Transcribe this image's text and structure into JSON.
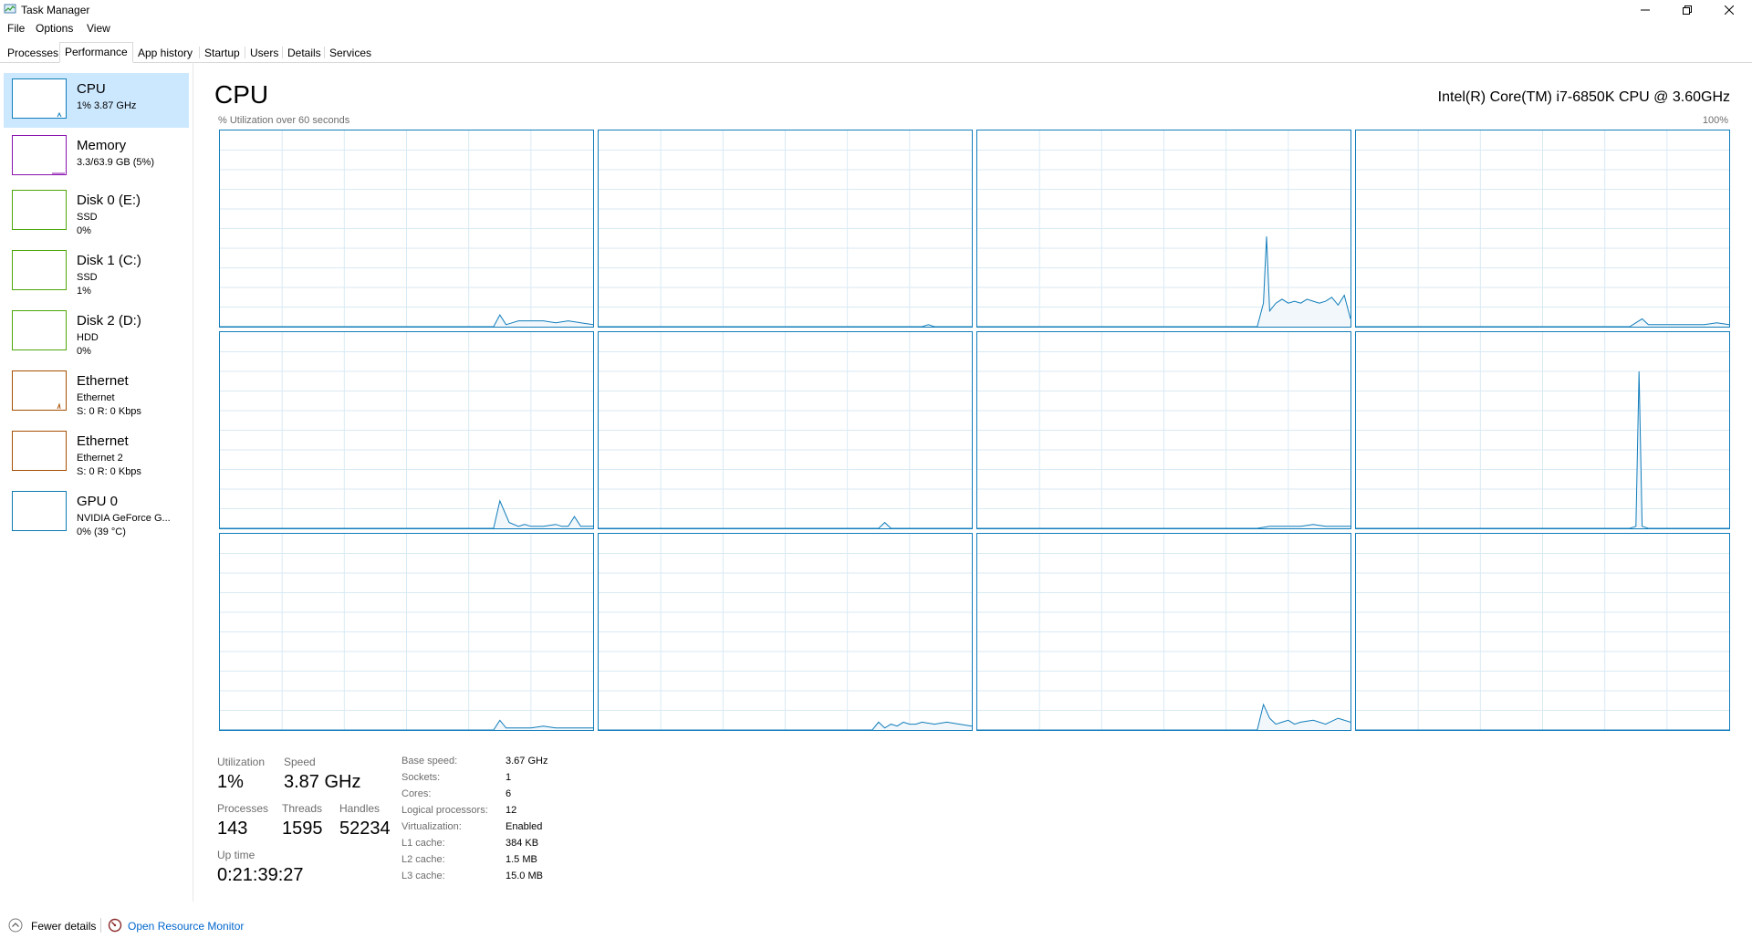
{
  "window": {
    "title": "Task Manager"
  },
  "menu": [
    "File",
    "Options",
    "View"
  ],
  "tabs": [
    "Processes",
    "Performance",
    "App history",
    "Startup",
    "Users",
    "Details",
    "Services"
  ],
  "sidebar": [
    {
      "title": "CPU",
      "lines": [
        "1% 3.87 GHz"
      ],
      "color": "#117dbb"
    },
    {
      "title": "Memory",
      "lines": [
        "3.3/63.9 GB (5%)"
      ],
      "color": "#8b12ae"
    },
    {
      "title": "Disk 0 (E:)",
      "lines": [
        "SSD",
        "0%"
      ],
      "color": "#4da60c"
    },
    {
      "title": "Disk 1 (C:)",
      "lines": [
        "SSD",
        "1%"
      ],
      "color": "#4da60c"
    },
    {
      "title": "Disk 2 (D:)",
      "lines": [
        "HDD",
        "0%"
      ],
      "color": "#4da60c"
    },
    {
      "title": "Ethernet",
      "lines": [
        "Ethernet",
        "S: 0 R: 0 Kbps"
      ],
      "color": "#a74f01"
    },
    {
      "title": "Ethernet",
      "lines": [
        "Ethernet 2",
        "S: 0 R: 0 Kbps"
      ],
      "color": "#a74f01"
    },
    {
      "title": "GPU 0",
      "lines": [
        "NVIDIA GeForce G...",
        "0% (39 °C)"
      ],
      "color": "#0e7bb0"
    }
  ],
  "main": {
    "title": "CPU",
    "cpu_model": "Intel(R) Core(TM) i7-6850K CPU @ 3.60GHz",
    "util_label": "% Utilization over 60 seconds",
    "util_max": "100%"
  },
  "chart_data": {
    "type": "area",
    "ylim": [
      0,
      100
    ],
    "xlim": [
      0,
      60
    ],
    "grid": true,
    "color": "#117dbb",
    "series": [
      {
        "values": [
          [
            0,
            0
          ],
          [
            44,
            0
          ],
          [
            45,
            6
          ],
          [
            46,
            1
          ],
          [
            47,
            2
          ],
          [
            48,
            3
          ],
          [
            50,
            3
          ],
          [
            52,
            3
          ],
          [
            54,
            2
          ],
          [
            56,
            3
          ],
          [
            58,
            2
          ],
          [
            60,
            1
          ]
        ]
      },
      {
        "values": [
          [
            0,
            0
          ],
          [
            52,
            0
          ],
          [
            53,
            1
          ],
          [
            54,
            0
          ],
          [
            60,
            0
          ]
        ]
      },
      {
        "values": [
          [
            0,
            0
          ],
          [
            45,
            0
          ],
          [
            46,
            12
          ],
          [
            46.5,
            46
          ],
          [
            47,
            8
          ],
          [
            48,
            12
          ],
          [
            49,
            14
          ],
          [
            50,
            12
          ],
          [
            51,
            13
          ],
          [
            52,
            12
          ],
          [
            53,
            14
          ],
          [
            54,
            13
          ],
          [
            55,
            12
          ],
          [
            56,
            13
          ],
          [
            57,
            15
          ],
          [
            58,
            11
          ],
          [
            59,
            16
          ],
          [
            60,
            4
          ]
        ]
      },
      {
        "values": [
          [
            0,
            0
          ],
          [
            44,
            0
          ],
          [
            46,
            4
          ],
          [
            47,
            1
          ],
          [
            50,
            1
          ],
          [
            53,
            1
          ],
          [
            56,
            1
          ],
          [
            58,
            2
          ],
          [
            60,
            1
          ]
        ]
      },
      {
        "values": [
          [
            0,
            0
          ],
          [
            44,
            0
          ],
          [
            45,
            14
          ],
          [
            46.5,
            3
          ],
          [
            48,
            1
          ],
          [
            49,
            2
          ],
          [
            50,
            1
          ],
          [
            52,
            1
          ],
          [
            54,
            2
          ],
          [
            55,
            1
          ],
          [
            56,
            1
          ],
          [
            57,
            6
          ],
          [
            58,
            1
          ],
          [
            59,
            1
          ],
          [
            60,
            1
          ]
        ]
      },
      {
        "values": [
          [
            0,
            0
          ],
          [
            45,
            0
          ],
          [
            46,
            3
          ],
          [
            47,
            0
          ],
          [
            60,
            0
          ]
        ]
      },
      {
        "values": [
          [
            0,
            0
          ],
          [
            45,
            0
          ],
          [
            47,
            1
          ],
          [
            50,
            1
          ],
          [
            52,
            1
          ],
          [
            54,
            2
          ],
          [
            56,
            1
          ],
          [
            58,
            1
          ],
          [
            60,
            1
          ]
        ]
      },
      {
        "values": [
          [
            0,
            0
          ],
          [
            44,
            0
          ],
          [
            45,
            1
          ],
          [
            45.5,
            80
          ],
          [
            46,
            1
          ],
          [
            47,
            0
          ],
          [
            60,
            0
          ]
        ]
      },
      {
        "values": [
          [
            0,
            0
          ],
          [
            44,
            0
          ],
          [
            45,
            5
          ],
          [
            46,
            1
          ],
          [
            48,
            1
          ],
          [
            50,
            1
          ],
          [
            52,
            2
          ],
          [
            54,
            1
          ],
          [
            56,
            1
          ],
          [
            58,
            1
          ],
          [
            60,
            1
          ]
        ]
      },
      {
        "values": [
          [
            0,
            0
          ],
          [
            44,
            0
          ],
          [
            45,
            4
          ],
          [
            46,
            1
          ],
          [
            47,
            3
          ],
          [
            48,
            2
          ],
          [
            49,
            4
          ],
          [
            50,
            3
          ],
          [
            51,
            3
          ],
          [
            52,
            4
          ],
          [
            54,
            3
          ],
          [
            56,
            4
          ],
          [
            58,
            3
          ],
          [
            60,
            2
          ]
        ]
      },
      {
        "values": [
          [
            0,
            0
          ],
          [
            45,
            0
          ],
          [
            46,
            13
          ],
          [
            47,
            6
          ],
          [
            48,
            3
          ],
          [
            49,
            4
          ],
          [
            50,
            5
          ],
          [
            51,
            3
          ],
          [
            52,
            4
          ],
          [
            54,
            5
          ],
          [
            56,
            3
          ],
          [
            58,
            6
          ],
          [
            60,
            4
          ]
        ]
      },
      {
        "values": [
          [
            0,
            0
          ],
          [
            60,
            0
          ]
        ]
      }
    ]
  },
  "stats": {
    "utilization": {
      "label": "Utilization",
      "value": "1%"
    },
    "speed": {
      "label": "Speed",
      "value": "3.87 GHz"
    },
    "processes": {
      "label": "Processes",
      "value": "143"
    },
    "threads": {
      "label": "Threads",
      "value": "1595"
    },
    "handles": {
      "label": "Handles",
      "value": "52234"
    },
    "uptime": {
      "label": "Up time",
      "value": "0:21:39:27"
    }
  },
  "specs": [
    {
      "label": "Base speed:",
      "value": "3.67 GHz"
    },
    {
      "label": "Sockets:",
      "value": "1"
    },
    {
      "label": "Cores:",
      "value": "6"
    },
    {
      "label": "Logical processors:",
      "value": "12"
    },
    {
      "label": "Virtualization:",
      "value": "Enabled"
    },
    {
      "label": "L1 cache:",
      "value": "384 KB"
    },
    {
      "label": "L2 cache:",
      "value": "1.5 MB"
    },
    {
      "label": "L3 cache:",
      "value": "15.0 MB"
    }
  ],
  "footer": {
    "fewer_details": "Fewer details",
    "resource_monitor": "Open Resource Monitor"
  }
}
